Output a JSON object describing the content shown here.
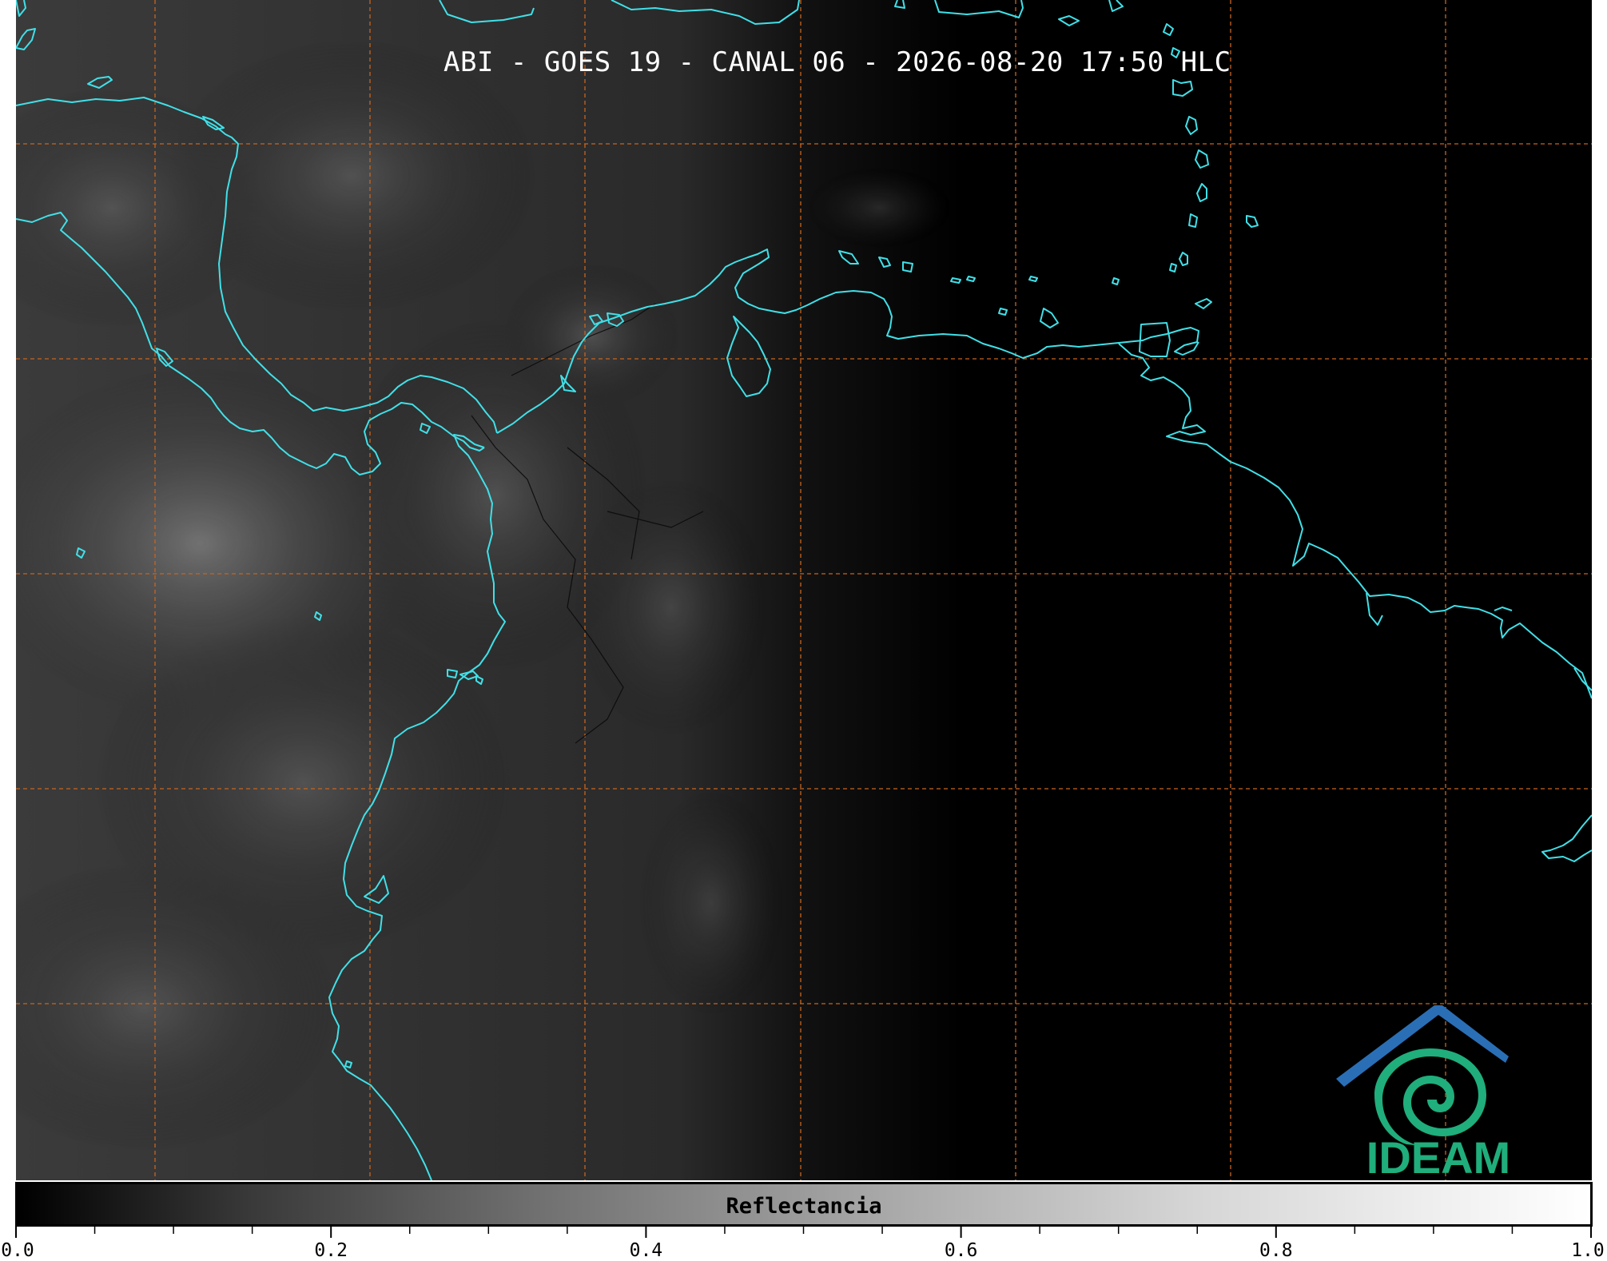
{
  "header": {
    "title": "ABI - GOES 19 - CANAL 06 - 2026-08-20 17:50 HLC"
  },
  "map": {
    "background": "#000000",
    "coastline_color": "#40e0e8",
    "grid_color": "#c8641e"
  },
  "logo": {
    "text": "IDEAM",
    "color_top": "#2a6fb6",
    "color_bottom": "#1fae7c"
  },
  "colorbar": {
    "label": "Reflectancia",
    "min": 0.0,
    "max": 1.0,
    "tick_labels": [
      "0.0",
      "0.2",
      "0.4",
      "0.6",
      "0.8",
      "1.0"
    ]
  }
}
